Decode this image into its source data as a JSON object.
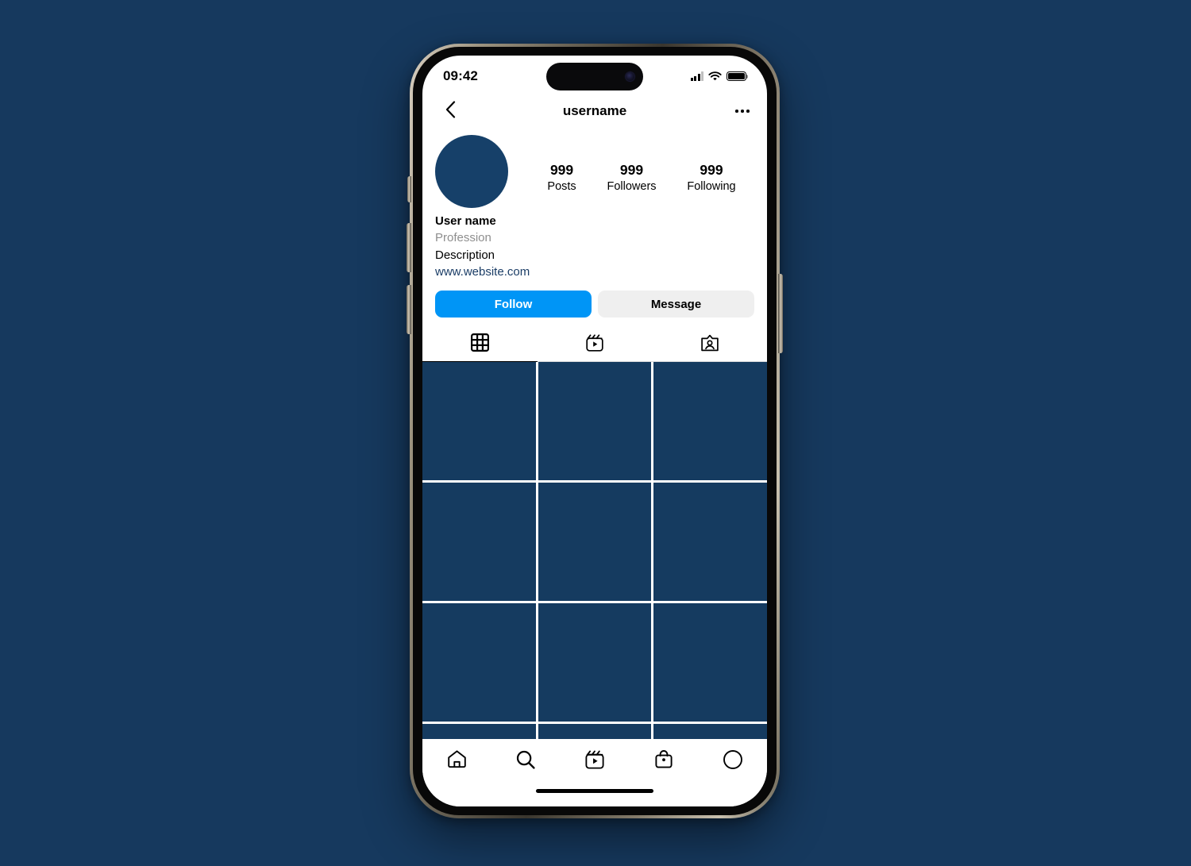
{
  "theme": {
    "page_background": "#16395e",
    "accent_blue": "#0095f6",
    "secondary_button": "#efefef",
    "placeholder_tile": "#153b60",
    "avatar_color": "#164069",
    "link_color": "#1b3d66",
    "muted_text": "#8e8e8e"
  },
  "status_bar": {
    "time": "09:42",
    "cellular_icon": "cellular-signal-icon",
    "wifi_icon": "wifi-icon",
    "battery_icon": "battery-full-icon",
    "battery_level_percent": 100,
    "camera_icon": "front-camera-icon"
  },
  "header": {
    "back_icon": "chevron-left-icon",
    "title": "username",
    "more_icon": "ellipsis-icon"
  },
  "profile": {
    "avatar_name": "profile-avatar",
    "stats": [
      {
        "value": "999",
        "label": "Posts"
      },
      {
        "value": "999",
        "label": "Followers"
      },
      {
        "value": "999",
        "label": "Following"
      }
    ],
    "full_name": "User name",
    "profession": "Profession",
    "description": "Description",
    "website": "www.website.com",
    "actions": {
      "follow_label": "Follow",
      "message_label": "Message"
    }
  },
  "content_tabs": [
    {
      "name": "tab-grid",
      "icon": "grid-icon",
      "active": true
    },
    {
      "name": "tab-reels",
      "icon": "reels-icon",
      "active": false
    },
    {
      "name": "tab-tagged",
      "icon": "tagged-person-icon",
      "active": false
    }
  ],
  "post_grid": {
    "columns": 3,
    "tiles": [
      1,
      2,
      3,
      4,
      5,
      6,
      7,
      8,
      9,
      10,
      11,
      12
    ]
  },
  "bottom_nav": [
    {
      "name": "nav-home",
      "icon": "home-icon"
    },
    {
      "name": "nav-search",
      "icon": "search-icon"
    },
    {
      "name": "nav-reels",
      "icon": "reels-icon"
    },
    {
      "name": "nav-shop",
      "icon": "shopping-bag-icon"
    },
    {
      "name": "nav-profile",
      "icon": "profile-circle-icon"
    }
  ],
  "device": {
    "home_indicator": "home-indicator",
    "silent_switch": "silent-switch-button",
    "volume_up": "volume-up-button",
    "volume_down": "volume-down-button",
    "power": "power-button"
  }
}
